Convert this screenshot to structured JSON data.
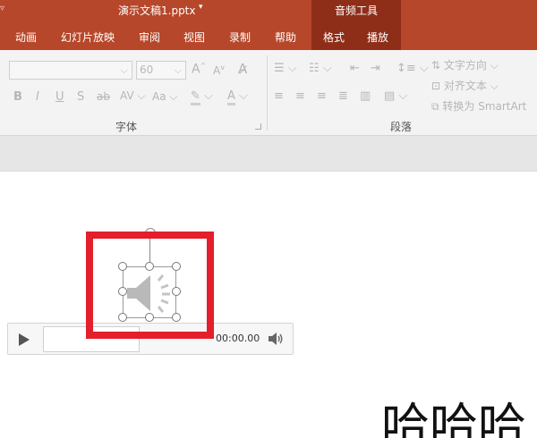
{
  "titlebar": {
    "doc_title": "演示文稿1.pptx",
    "caret": "▾",
    "quick_access": "▿",
    "context_group": "音频工具"
  },
  "tabs": [
    {
      "label": "动画"
    },
    {
      "label": "幻灯片放映"
    },
    {
      "label": "审阅"
    },
    {
      "label": "视图"
    },
    {
      "label": "录制"
    },
    {
      "label": "帮助"
    },
    {
      "label": "格式"
    },
    {
      "label": "播放"
    }
  ],
  "font_group": {
    "label": "字体",
    "font_name": "",
    "font_size": "60",
    "grow": "A",
    "shrink": "A",
    "bold": "B",
    "italic": "I",
    "underline": "U",
    "shadow": "S",
    "strike": "ab",
    "spacing": "AV",
    "case": "Aa",
    "highlight": "✎",
    "font_color": "A"
  },
  "paragraph_group": {
    "label": "段落",
    "text_direction": "文字方向",
    "align_text": "对齐文本",
    "smartart": "转换为 SmartArt"
  },
  "player": {
    "time": "00:00.00"
  },
  "slide": {
    "text": "哈哈哈"
  },
  "colors": {
    "ribbon_accent": "#b7472a",
    "context_tab": "#8e2e18",
    "annotation": "#e41e2b"
  }
}
